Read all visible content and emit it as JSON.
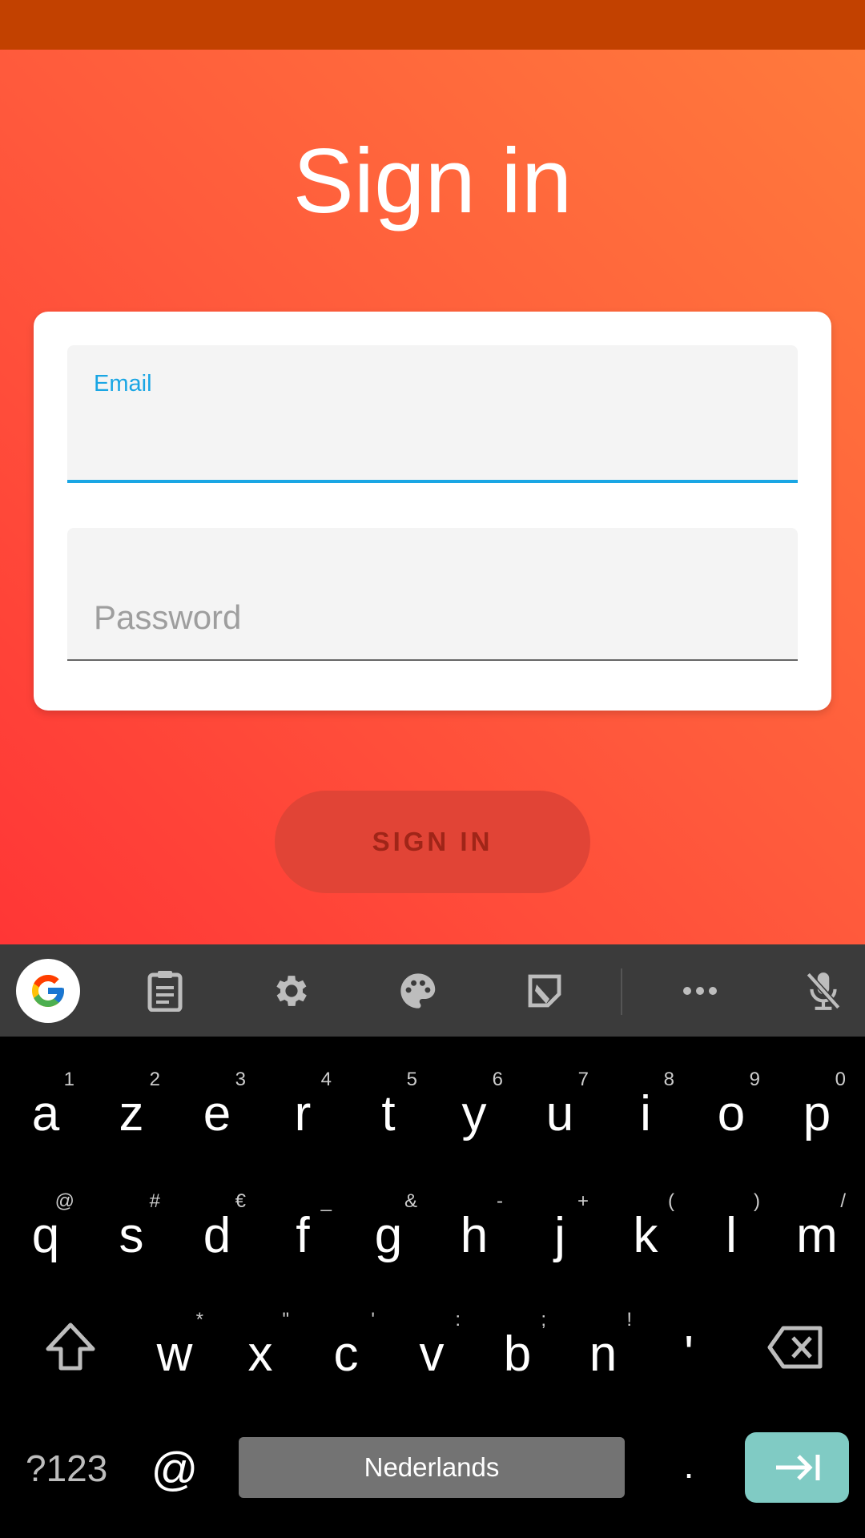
{
  "app": {
    "title": "Sign in",
    "email_label": "Email",
    "password_placeholder": "Password",
    "signin_button": "SIGN IN"
  },
  "keyboard": {
    "row1": [
      {
        "k": "a",
        "h": "1"
      },
      {
        "k": "z",
        "h": "2"
      },
      {
        "k": "e",
        "h": "3"
      },
      {
        "k": "r",
        "h": "4"
      },
      {
        "k": "t",
        "h": "5"
      },
      {
        "k": "y",
        "h": "6"
      },
      {
        "k": "u",
        "h": "7"
      },
      {
        "k": "i",
        "h": "8"
      },
      {
        "k": "o",
        "h": "9"
      },
      {
        "k": "p",
        "h": "0"
      }
    ],
    "row2": [
      {
        "k": "q",
        "h": "@"
      },
      {
        "k": "s",
        "h": "#"
      },
      {
        "k": "d",
        "h": "€"
      },
      {
        "k": "f",
        "h": "_"
      },
      {
        "k": "g",
        "h": "&"
      },
      {
        "k": "h",
        "h": "-"
      },
      {
        "k": "j",
        "h": "+"
      },
      {
        "k": "k",
        "h": "("
      },
      {
        "k": "l",
        "h": ")"
      },
      {
        "k": "m",
        "h": "/"
      }
    ],
    "row3": [
      {
        "k": "w",
        "h": "*"
      },
      {
        "k": "x",
        "h": "\""
      },
      {
        "k": "c",
        "h": "'"
      },
      {
        "k": "v",
        "h": ":"
      },
      {
        "k": "b",
        "h": ";"
      },
      {
        "k": "n",
        "h": "!"
      },
      {
        "k": "'",
        "h": ""
      }
    ],
    "symbols_key": "?123",
    "at_key": "@",
    "space_label": "Nederlands",
    "period_key": "."
  },
  "toolbar": {
    "icons": [
      "google-icon",
      "clipboard-icon",
      "gear-icon",
      "palette-icon",
      "sticker-icon",
      "more-icon",
      "mic-off-icon"
    ]
  },
  "colors": {
    "accent": "#1aa6e4",
    "status_bar": "#c24100",
    "button": "#e14436",
    "enter_key": "#80cbc4"
  }
}
